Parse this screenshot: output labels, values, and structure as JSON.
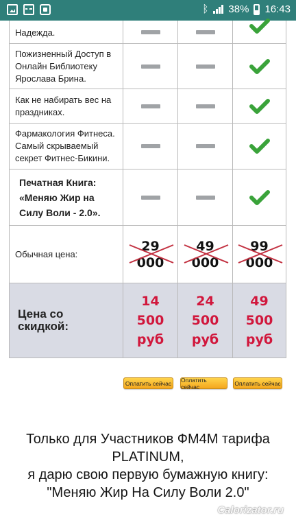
{
  "status_bar": {
    "battery": "38%",
    "time": "16:43",
    "icons": [
      "photo-icon",
      "pulse-icon",
      "lock-icon",
      "bluetooth-icon",
      "signal-icon",
      "battery-icon"
    ]
  },
  "table": {
    "rows": [
      {
        "label": "Надежда.",
        "values": [
          "dash",
          "dash",
          "check"
        ]
      },
      {
        "label": "Пожизненный Доступ в Онлайн Библиотеку Ярослава Брина.",
        "values": [
          "dash",
          "dash",
          "check"
        ]
      },
      {
        "label": "Как не набирать вес на праздниках.",
        "values": [
          "dash",
          "dash",
          "check"
        ]
      },
      {
        "label": "Фармакология Фитнеса. Самый скрываемый секрет Фитнес-Бикини.",
        "values": [
          "dash",
          "dash",
          "check"
        ]
      },
      {
        "label": "Печатная Книга: «Меняю Жир на Силу Воли - 2.0».",
        "values": [
          "dash",
          "dash",
          "check"
        ]
      }
    ],
    "regular_price": {
      "label": "Обычная цена:",
      "values": [
        "29 000",
        "49 000",
        "99 000"
      ]
    },
    "discount_price": {
      "label": "Цена со скидкой:",
      "values": [
        "14 500 руб",
        "24 500 руб",
        "49 500 руб"
      ]
    }
  },
  "buttons": {
    "pay_1": "Оплатить сейчас",
    "pay_2": "Оплатить сейчас",
    "pay_3": "Оплатить сейчас"
  },
  "footer": {
    "line1": "Только для Участников ФМ4М тарифа",
    "line2": "PLATINUM,",
    "line3": "я дарю свою первую бумажную книгу:",
    "line4": "\"Меняю Жир На Силу Воли 2.0\""
  },
  "watermark": "Calorizator.ru",
  "colors": {
    "status_bar": "#2f7f7a",
    "check": "#3aa33a",
    "discount_price": "#d1173c",
    "cross": "#c23040",
    "highlight_row": "#d9dbe4"
  }
}
